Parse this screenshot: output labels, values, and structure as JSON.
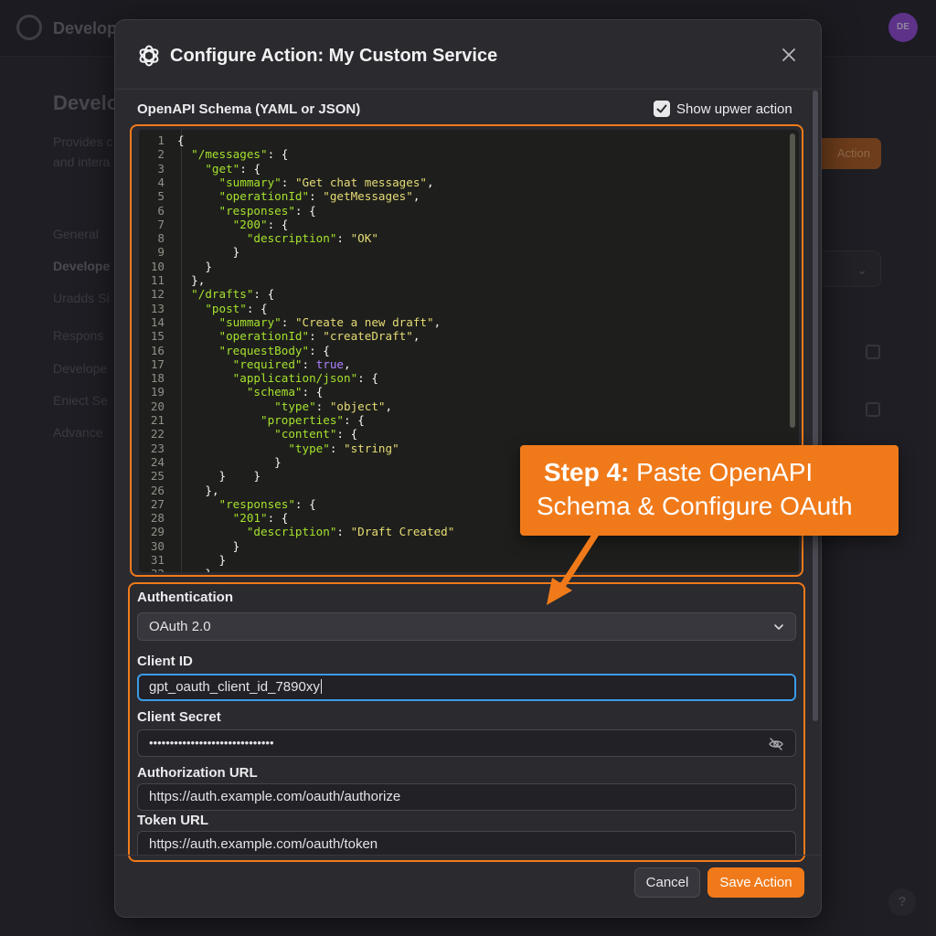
{
  "background": {
    "brand": "Develop",
    "avatar_initials": "DE",
    "heading": "Develo",
    "description_line1": "Provides c",
    "description_line2": "and intera",
    "nav": [
      "General",
      "Develope",
      "Uradds Si",
      "Respons",
      "Develope",
      "Eniect Se",
      "Advance"
    ],
    "action_button": "Action",
    "help_label": "?"
  },
  "modal": {
    "title": "Configure Action: My Custom Service",
    "schema_label": "OpenAPI Schema (YAML or JSON)",
    "show_action_label": "Show upwer action",
    "show_action_checked": true
  },
  "schema_code": [
    "{",
    "  \"/messages\": {",
    "    \"get\": {",
    "      \"summary\": \"Get chat messages\",",
    "      \"operationId\": \"getMessages\",",
    "      \"responses\": {",
    "        \"200\": {",
    "          \"description\": \"OK\"",
    "        }",
    "    }",
    "  },",
    "  \"/drafts\": {",
    "    \"post\": {",
    "      \"summary\": \"Create a new draft\",",
    "      \"operationId\": \"createDraft\",",
    "      \"requestBody\": {",
    "        \"required\": true,",
    "        \"application/json\": {",
    "          \"schema\": {",
    "              \"type\": \"object\",",
    "            \"properties\": {",
    "              \"content\": {",
    "                \"type\": \"string\"",
    "              }",
    "      }    }",
    "    },",
    "      \"responses\": {",
    "        \"201\": {",
    "          \"description\": \"Draft Created\"",
    "        }",
    "      }",
    "    }"
  ],
  "auth": {
    "section_label": "Authentication",
    "type_value": "OAuth 2.0",
    "client_id_label": "Client ID",
    "client_id_value": "gpt_oauth_client_id_7890xy",
    "client_secret_label": "Client Secret",
    "client_secret_value": "••••••••••••••••••••••••••••••",
    "auth_url_label": "Authorization URL",
    "auth_url_value": "https://auth.example.com/oauth/authorize",
    "token_url_label": "Token URL",
    "token_url_value": "https://auth.example.com/oauth/token"
  },
  "footer": {
    "cancel_label": "Cancel",
    "save_label": "Save Action"
  },
  "callout": {
    "step": "Step 4:",
    "line1_rest": " Paste OpenAPI",
    "line2": "Schema & Configure OAuth"
  },
  "colors": {
    "accent": "#f07a1a",
    "focus": "#3a9ce8",
    "json_key": "#a6e22e",
    "json_string": "#e6db74",
    "json_bool": "#ae81ff"
  }
}
